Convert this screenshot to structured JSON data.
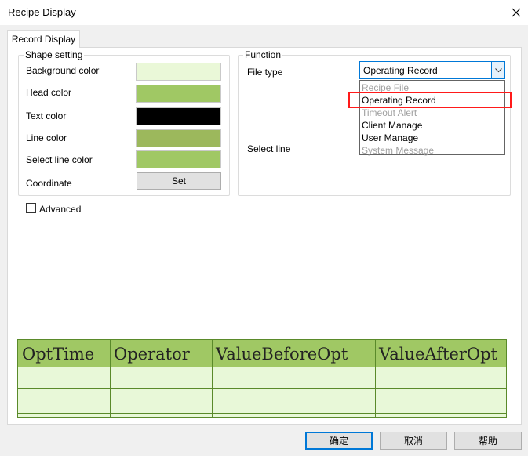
{
  "window": {
    "title": "Recipe Display"
  },
  "tabs": [
    {
      "label": "Record Display"
    }
  ],
  "shape_setting": {
    "legend": "Shape setting",
    "rows": [
      {
        "label": "Background color",
        "color": "#eaf8d8"
      },
      {
        "label": "Head color",
        "color": "#a0c864"
      },
      {
        "label": "Text color",
        "color": "#000000"
      },
      {
        "label": "Line color",
        "color": "#9cb85c"
      },
      {
        "label": "Select line color",
        "color": "#a0c864"
      }
    ],
    "coordinate_label": "Coordinate",
    "set_label": "Set"
  },
  "advanced": {
    "label": "Advanced",
    "checked": false
  },
  "function": {
    "legend": "Function",
    "file_type_label": "File type",
    "file_type_value": "Operating Record",
    "select_line_label": "Select line",
    "options": [
      {
        "label": "Recipe File",
        "enabled": false
      },
      {
        "label": "Operating Record",
        "enabled": true
      },
      {
        "label": "Timeout Alert",
        "enabled": false
      },
      {
        "label": "Client Manage",
        "enabled": true
      },
      {
        "label": "User Manage",
        "enabled": true
      },
      {
        "label": "System Message",
        "enabled": false
      }
    ]
  },
  "preview_table": {
    "columns": [
      "OptTime",
      "Operator",
      "ValueBeforeOpt",
      "ValueAfterOpt"
    ]
  },
  "buttons": {
    "ok": "确定",
    "cancel": "取消",
    "help": "帮助"
  }
}
